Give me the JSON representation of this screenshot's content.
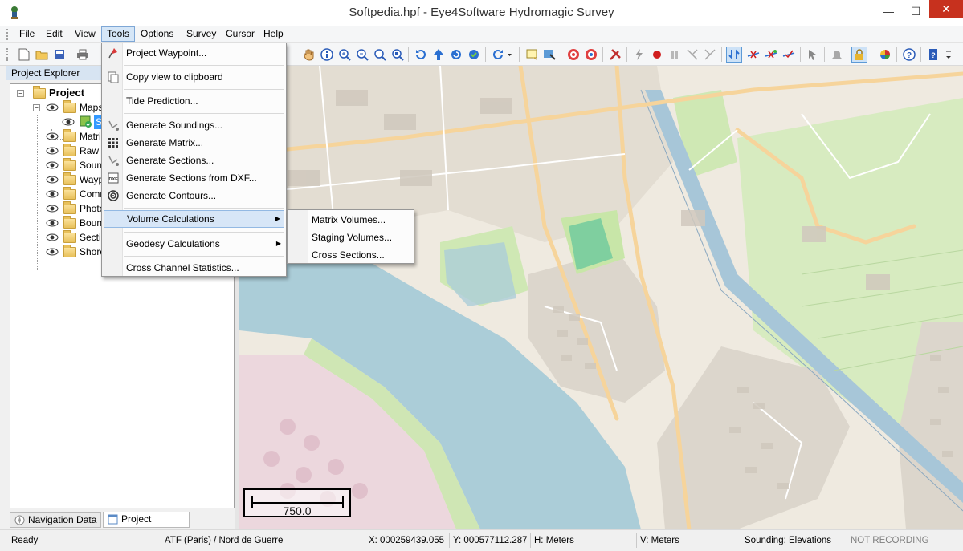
{
  "window": {
    "title": "Softpedia.hpf - Eye4Software Hydromagic Survey",
    "minimize_glyph": "—",
    "maximize_glyph": "☐",
    "close_glyph": "✕"
  },
  "menubar": {
    "items": [
      "File",
      "Edit",
      "View",
      "Tools",
      "Options",
      "Survey",
      "Cursor",
      "Help"
    ],
    "active": "Tools"
  },
  "toolbar": {
    "icons": [
      "new-file-icon",
      "open-folder-icon",
      "save-icon",
      "print-icon",
      "hand-pan-icon",
      "info-icon",
      "zoom-in-icon",
      "zoom-out-icon",
      "zoom-window-icon",
      "zoom-extent-icon",
      "rotate-left-icon",
      "arrow-up-icon",
      "refresh-icon",
      "refresh-green-icon",
      "redo-icon",
      "note-icon",
      "map-import-icon",
      "target-icon",
      "target-alt-icon",
      "tools-icon",
      "lightning-icon",
      "record-icon",
      "pause-icon",
      "route-icon",
      "route-alt-icon",
      "sync-icon",
      "cross-line-icon",
      "cross-line-alt-icon",
      "check-line-icon",
      "cursor-icon",
      "bell-icon",
      "lock-icon",
      "color-wheel-icon",
      "help-icon",
      "manual-icon"
    ]
  },
  "explorer": {
    "title": "Project Explorer",
    "root": "Project",
    "maps_label": "Maps",
    "map_child_label": "So",
    "items": [
      "Matric",
      "Raw D",
      "Sound",
      "Wayp",
      "Comm",
      "Photo",
      "Bound",
      "Sectio",
      "Shore"
    ],
    "tabs": {
      "navigation": "Navigation Data",
      "explorer": "Project Explorer"
    }
  },
  "tools_menu": {
    "groups": [
      [
        {
          "label": "Project Waypoint...",
          "icon": "waypoint-flag-icon"
        }
      ],
      [
        {
          "label": "Copy view to clipboard",
          "icon": "clipboard-icon"
        }
      ],
      [
        {
          "label": "Tide Prediction...",
          "icon": ""
        }
      ],
      [
        {
          "label": "Generate Soundings...",
          "icon": "soundings-icon"
        },
        {
          "label": "Generate Matrix...",
          "icon": "matrix-grid-icon"
        },
        {
          "label": "Generate Sections...",
          "icon": "sections-icon"
        },
        {
          "label": "Generate Sections from DXF...",
          "icon": "dxf-icon"
        },
        {
          "label": "Generate Contours...",
          "icon": "contours-icon"
        }
      ],
      [
        {
          "label": "Volume Calculations",
          "icon": "",
          "submenu": true
        }
      ],
      [
        {
          "label": "Geodesy Calculations",
          "icon": "",
          "submenu": true
        }
      ],
      [
        {
          "label": "Cross Channel Statistics...",
          "icon": ""
        }
      ]
    ],
    "hovered": "Volume Calculations",
    "submenu_arrow": "▶"
  },
  "volume_submenu": {
    "items": [
      "Matrix Volumes...",
      "Staging Volumes...",
      "Cross Sections..."
    ]
  },
  "map": {
    "scale_value": "750.0",
    "colors": {
      "land": "#efeae0",
      "water": "#abcdd8",
      "park": "#cdebb0",
      "built": "#e0dad0",
      "road_major": "#f8d79e",
      "canal": "#a7c6d8"
    }
  },
  "statusbar": {
    "state": "Ready",
    "projection": "ATF (Paris) / Nord de Guerre",
    "x_coord": "X: 000259439.055",
    "y_coord": "Y: 000577112.287",
    "h_units": "H: Meters",
    "v_units": "V: Meters",
    "sounding_mode": "Sounding: Elevations",
    "recording": "NOT RECORDING"
  }
}
